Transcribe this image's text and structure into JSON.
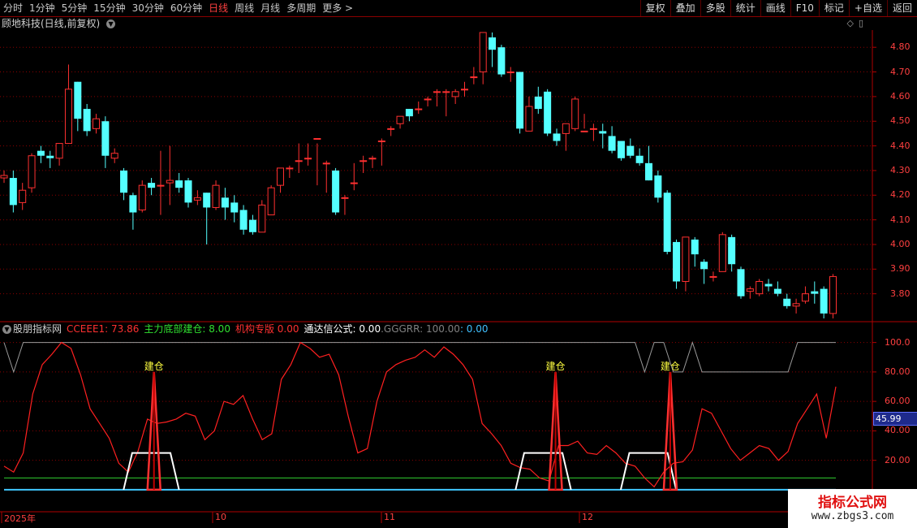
{
  "toolbar": {
    "periods": [
      "分时",
      "1分钟",
      "5分钟",
      "15分钟",
      "30分钟",
      "60分钟",
      "日线",
      "周线",
      "月线",
      "多周期",
      "更多 >"
    ],
    "active_period": "日线",
    "right_buttons": [
      "复权",
      "叠加",
      "多股",
      "统计",
      "画线",
      "F10",
      "标记",
      "+自选",
      "返回"
    ]
  },
  "chart_title": "顾地科技(日线,前复权)",
  "price_axis": [
    "4.80",
    "4.70",
    "4.60",
    "4.50",
    "4.40",
    "4.30",
    "4.20",
    "4.10",
    "4.00",
    "3.90",
    "3.80"
  ],
  "indicator": {
    "name": "股朋指标网",
    "cceee1_label": "CCEEE1: 73.86",
    "zhuli_label": "主力底部建仓: 8.00",
    "jigou_label": "机构专版  0.00",
    "tongda_label": "通达信公式: 0.00",
    "gggrr_label": ".GGGRR: 100.00",
    "tail_label": ": 0.00",
    "axis": [
      "100.0",
      "80.00",
      "60.00",
      "40.00",
      "20.00"
    ],
    "current_value": "45.99",
    "signal_label": "建仓"
  },
  "date_axis": [
    "2025年",
    "10",
    "11",
    "12"
  ],
  "watermark": {
    "title": "指标公式网",
    "url": "www.zbgs3.com"
  },
  "colors": {
    "up": "#ff3030",
    "down": "#54ffff",
    "grid": "#8b0000",
    "main_line": "#ff2020",
    "signal": "#ff3030"
  },
  "chart_data": [
    {
      "type": "candlestick",
      "title": "顾地科技(日线,前复权)",
      "ylim": [
        3.7,
        4.86
      ],
      "candles": [
        [
          4.27,
          4.28,
          4.25,
          4.3
        ],
        [
          4.27,
          4.16,
          4.13,
          4.3
        ],
        [
          4.17,
          4.22,
          4.14,
          4.25
        ],
        [
          4.23,
          4.36,
          4.21,
          4.37
        ],
        [
          4.38,
          4.36,
          4.33,
          4.4
        ],
        [
          4.36,
          4.35,
          4.31,
          4.38
        ],
        [
          4.35,
          4.41,
          4.32,
          4.41
        ],
        [
          4.41,
          4.63,
          4.41,
          4.73
        ],
        [
          4.66,
          4.51,
          4.46,
          4.66
        ],
        [
          4.55,
          4.46,
          4.44,
          4.57
        ],
        [
          4.47,
          4.51,
          4.45,
          4.53
        ],
        [
          4.5,
          4.36,
          4.31,
          4.52
        ],
        [
          4.35,
          4.37,
          4.33,
          4.39
        ],
        [
          4.3,
          4.21,
          4.18,
          4.31
        ],
        [
          4.2,
          4.13,
          4.06,
          4.21
        ],
        [
          4.14,
          4.24,
          4.13,
          4.26
        ],
        [
          4.25,
          4.23,
          4.2,
          4.27
        ],
        [
          4.24,
          4.24,
          4.12,
          4.38
        ],
        [
          4.25,
          4.26,
          4.16,
          4.4
        ],
        [
          4.26,
          4.23,
          4.21,
          4.29
        ],
        [
          4.26,
          4.17,
          4.15,
          4.27
        ],
        [
          4.18,
          4.19,
          4.16,
          4.22
        ],
        [
          4.21,
          4.15,
          4.0,
          4.21
        ],
        [
          4.15,
          4.24,
          4.14,
          4.26
        ],
        [
          4.19,
          4.15,
          4.1,
          4.23
        ],
        [
          4.17,
          4.13,
          4.09,
          4.2
        ],
        [
          4.14,
          4.06,
          4.04,
          4.16
        ],
        [
          4.1,
          4.05,
          4.04,
          4.12
        ],
        [
          4.05,
          4.16,
          4.06,
          4.18
        ],
        [
          4.12,
          4.23,
          4.12,
          4.24
        ],
        [
          4.24,
          4.31,
          4.21,
          4.31
        ],
        [
          4.31,
          4.31,
          4.27,
          4.32
        ],
        [
          4.34,
          4.34,
          4.29,
          4.41
        ],
        [
          4.35,
          4.35,
          4.32,
          4.41
        ],
        [
          4.43,
          4.43,
          4.24,
          4.41
        ],
        [
          4.33,
          4.33,
          4.21,
          4.34
        ],
        [
          4.3,
          4.13,
          4.12,
          4.31
        ],
        [
          4.19,
          4.19,
          4.12,
          4.2
        ],
        [
          4.25,
          4.25,
          4.22,
          4.33
        ],
        [
          4.34,
          4.34,
          4.29,
          4.36
        ],
        [
          4.35,
          4.35,
          4.31,
          4.36
        ],
        [
          4.42,
          4.42,
          4.32,
          4.43
        ],
        [
          4.47,
          4.47,
          4.44,
          4.48
        ],
        [
          4.49,
          4.52,
          4.47,
          4.52
        ],
        [
          4.55,
          4.52,
          4.5,
          4.55
        ],
        [
          4.55,
          4.55,
          4.53,
          4.58
        ],
        [
          4.59,
          4.59,
          4.56,
          4.6
        ],
        [
          4.62,
          4.62,
          4.56,
          4.63
        ],
        [
          4.62,
          4.62,
          4.52,
          4.63
        ],
        [
          4.6,
          4.62,
          4.57,
          4.63
        ],
        [
          4.63,
          4.63,
          4.6,
          4.66
        ],
        [
          4.68,
          4.68,
          4.65,
          4.72
        ],
        [
          4.7,
          4.86,
          4.65,
          4.86
        ],
        [
          4.84,
          4.79,
          4.72,
          4.86
        ],
        [
          4.8,
          4.69,
          4.68,
          4.81
        ],
        [
          4.7,
          4.7,
          4.66,
          4.72
        ],
        [
          4.7,
          4.47,
          4.45,
          4.7
        ],
        [
          4.46,
          4.56,
          4.48,
          4.6
        ],
        [
          4.6,
          4.55,
          4.53,
          4.64
        ],
        [
          4.62,
          4.45,
          4.44,
          4.63
        ],
        [
          4.45,
          4.42,
          4.4,
          4.47
        ],
        [
          4.45,
          4.49,
          4.38,
          4.49
        ],
        [
          4.47,
          4.59,
          4.46,
          4.6
        ],
        [
          4.46,
          4.46,
          4.47,
          4.53
        ],
        [
          4.47,
          4.47,
          4.42,
          4.49
        ],
        [
          4.46,
          4.45,
          4.39,
          4.49
        ],
        [
          4.44,
          4.38,
          4.37,
          4.48
        ],
        [
          4.42,
          4.35,
          4.34,
          4.42
        ],
        [
          4.4,
          4.36,
          4.35,
          4.43
        ],
        [
          4.36,
          4.33,
          4.32,
          4.39
        ],
        [
          4.33,
          4.26,
          4.26,
          4.4
        ],
        [
          4.28,
          4.19,
          4.17,
          4.3
        ],
        [
          4.21,
          3.97,
          3.96,
          4.22
        ],
        [
          4.01,
          3.85,
          3.82,
          4.02
        ],
        [
          3.85,
          4.03,
          3.81,
          4.03
        ],
        [
          4.02,
          3.96,
          3.91,
          4.03
        ],
        [
          3.93,
          3.9,
          3.84,
          3.94
        ],
        [
          3.87,
          3.87,
          3.85,
          3.89
        ],
        [
          3.89,
          4.04,
          3.89,
          4.05
        ],
        [
          4.03,
          3.92,
          3.89,
          4.04
        ],
        [
          3.9,
          3.79,
          3.78,
          3.91
        ],
        [
          3.81,
          3.82,
          3.78,
          3.83
        ],
        [
          3.8,
          3.85,
          3.79,
          3.86
        ],
        [
          3.84,
          3.83,
          3.81,
          3.86
        ],
        [
          3.82,
          3.8,
          3.79,
          3.85
        ],
        [
          3.78,
          3.75,
          3.74,
          3.8
        ],
        [
          3.75,
          3.76,
          3.72,
          3.78
        ],
        [
          3.77,
          3.8,
          3.76,
          3.83
        ],
        [
          3.81,
          3.8,
          3.76,
          3.85
        ],
        [
          3.82,
          3.72,
          3.7,
          3.83
        ],
        [
          3.72,
          3.87,
          3.7,
          3.88
        ]
      ]
    },
    {
      "type": "line",
      "ylim": [
        -5,
        102
      ],
      "series": [
        {
          "name": "CCEEE1",
          "values": [
            16,
            12,
            25,
            65,
            85,
            92,
            100,
            96,
            78,
            55,
            45,
            35,
            18,
            12,
            26,
            48,
            45,
            46,
            48,
            52,
            50,
            34,
            40,
            60,
            58,
            64,
            48,
            34,
            38,
            75,
            85,
            100,
            96,
            90,
            92,
            78,
            50,
            25,
            28,
            60,
            80,
            85,
            88,
            90,
            95,
            90,
            97,
            92,
            85,
            75,
            45,
            38,
            30,
            18,
            15,
            14,
            8,
            6,
            30,
            30,
            33,
            25,
            24,
            30,
            25,
            18,
            16,
            8,
            2,
            12,
            18,
            19,
            27,
            55,
            52,
            40,
            28,
            20,
            25,
            30,
            28,
            20,
            26,
            45,
            55,
            65,
            35,
            70
          ]
        },
        {
          "name": "主力底部建仓",
          "values": [
            8,
            8,
            8,
            8,
            8,
            8,
            8,
            8,
            8,
            8,
            8,
            8,
            8,
            8,
            8,
            8,
            8,
            8,
            8,
            8,
            8,
            8,
            8,
            8,
            8,
            8,
            8,
            8,
            8,
            8,
            8,
            8,
            8,
            8,
            8,
            8,
            8,
            8,
            8,
            8,
            8,
            8,
            8,
            8,
            8,
            8,
            8,
            8,
            8,
            8,
            8,
            8,
            8,
            8,
            8,
            8,
            8,
            8,
            8,
            8,
            8,
            8,
            8,
            8,
            8,
            8,
            8,
            8,
            8,
            8,
            8,
            8,
            8,
            8,
            8,
            8,
            8,
            8,
            8,
            8,
            8,
            8,
            8,
            8,
            8,
            8,
            8,
            8
          ]
        },
        {
          "name": "GGGRR",
          "values": [
            100,
            80,
            100,
            100,
            100,
            100,
            100,
            100,
            100,
            100,
            100,
            100,
            100,
            100,
            100,
            100,
            100,
            100,
            100,
            100,
            100,
            100,
            100,
            100,
            100,
            100,
            100,
            100,
            100,
            100,
            100,
            100,
            100,
            100,
            100,
            100,
            100,
            100,
            100,
            100,
            100,
            100,
            100,
            100,
            100,
            100,
            100,
            100,
            100,
            100,
            100,
            100,
            100,
            100,
            100,
            100,
            100,
            100,
            100,
            100,
            100,
            100,
            100,
            100,
            100,
            100,
            100,
            80,
            100,
            100,
            80,
            80,
            100,
            80,
            80,
            80,
            80,
            80,
            80,
            80,
            80,
            80,
            80,
            100,
            100,
            100,
            100,
            100
          ]
        }
      ],
      "signals": [
        {
          "x": 15,
          "label": "建仓"
        },
        {
          "x": 57,
          "label": "建仓"
        },
        {
          "x": 69,
          "label": "建仓"
        }
      ]
    }
  ]
}
